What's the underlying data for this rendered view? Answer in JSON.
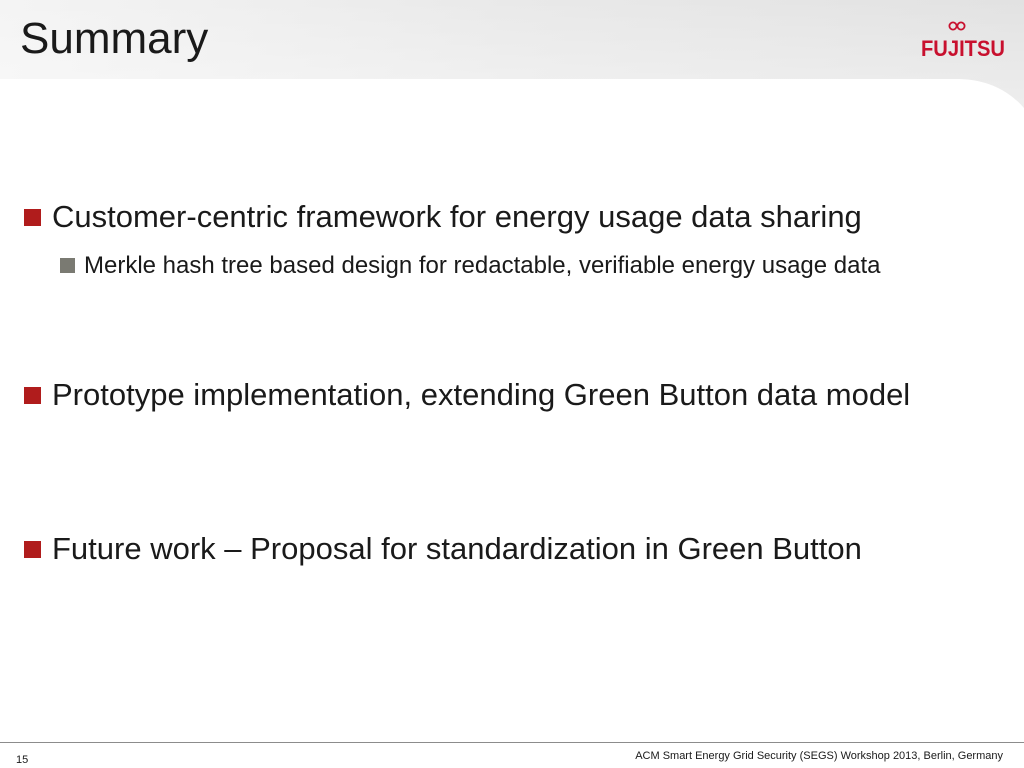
{
  "slide": {
    "title": "Summary",
    "logo_text": "FUJITSU",
    "bullets": [
      {
        "text": "Customer-centric framework for energy usage data sharing",
        "sub": [
          "Merkle hash tree based design for redactable, verifiable energy usage data"
        ]
      },
      {
        "text": "Prototype implementation, extending Green Button data model"
      },
      {
        "text": "Future work – Proposal for standardization in Green Button"
      }
    ],
    "footer": {
      "page_number": "15",
      "conference": "ACM Smart Energy Grid Security (SEGS) Workshop 2013, Berlin, Germany"
    }
  },
  "colors": {
    "bullet_primary": "#b01c1c",
    "bullet_secondary": "#7a7a72",
    "logo_red": "#c8102e",
    "header_gray": "#e6e6e6"
  },
  "icons": [
    "fujitsu-logo",
    "square-bullet"
  ]
}
